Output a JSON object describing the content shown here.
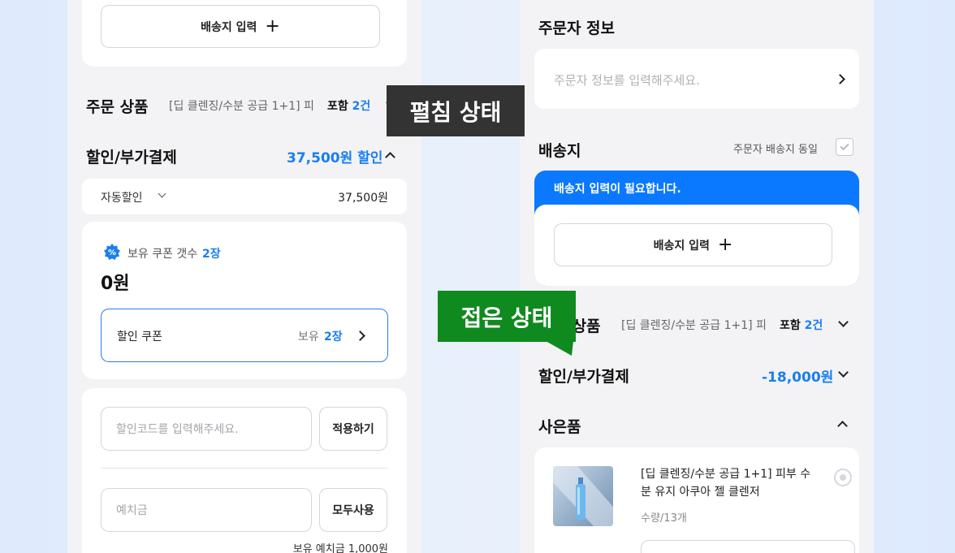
{
  "left": {
    "address_button": "배송지 입력",
    "order_products": {
      "title": "주문 상품",
      "summary": "[딥 클렌징/수분 공급 1+1] 피...",
      "include_label": "포함",
      "count": "2건"
    },
    "discount": {
      "title": "할인/부가결제",
      "amount": "37,500원 할인"
    },
    "auto_discount": {
      "label": "자동할인",
      "value": "37,500원"
    },
    "coupon": {
      "held_label": "보유 쿠폰 갯수",
      "held_count": "2장",
      "amount": "0원",
      "button_label": "할인 쿠폰",
      "button_held": "보유",
      "button_count": "2장"
    },
    "code": {
      "placeholder": "할인코드를 입력해주세요.",
      "apply": "적용하기"
    },
    "deposit": {
      "placeholder": "예치금",
      "use_all": "모두사용",
      "held": "보유 예치금 1,000원"
    }
  },
  "right": {
    "orderer": {
      "title": "주문자 정보",
      "placeholder": "주문자 정보를 입력해주세요."
    },
    "shipping": {
      "title": "배송지",
      "same_label": "주문자 배송지 동일",
      "notice": "배송지 입력이 필요합니다.",
      "button": "배송지 입력"
    },
    "order_products": {
      "title": "주문 상품",
      "summary": "[딥 클렌징/수분 공급 1+1] 피...",
      "include_label": "포함",
      "count": "2건"
    },
    "discount": {
      "title": "할인/부가결제",
      "amount": "-18,000원"
    },
    "gift": {
      "title": "사은품",
      "product_name": "[딥 클렌징/수분 공급 1+1] 피부 수분 유지 아쿠아 젤 클렌저",
      "quantity": "수량/13개"
    }
  },
  "callouts": {
    "expanded": "펼침 상태",
    "collapsed": "접은 상태"
  },
  "colors": {
    "accent_blue": "#1a7ef0",
    "notice_blue": "#0a78ff",
    "callout_dark": "#333333",
    "callout_green": "#0f8a1f",
    "panel_bg": "#f3f3f5"
  }
}
